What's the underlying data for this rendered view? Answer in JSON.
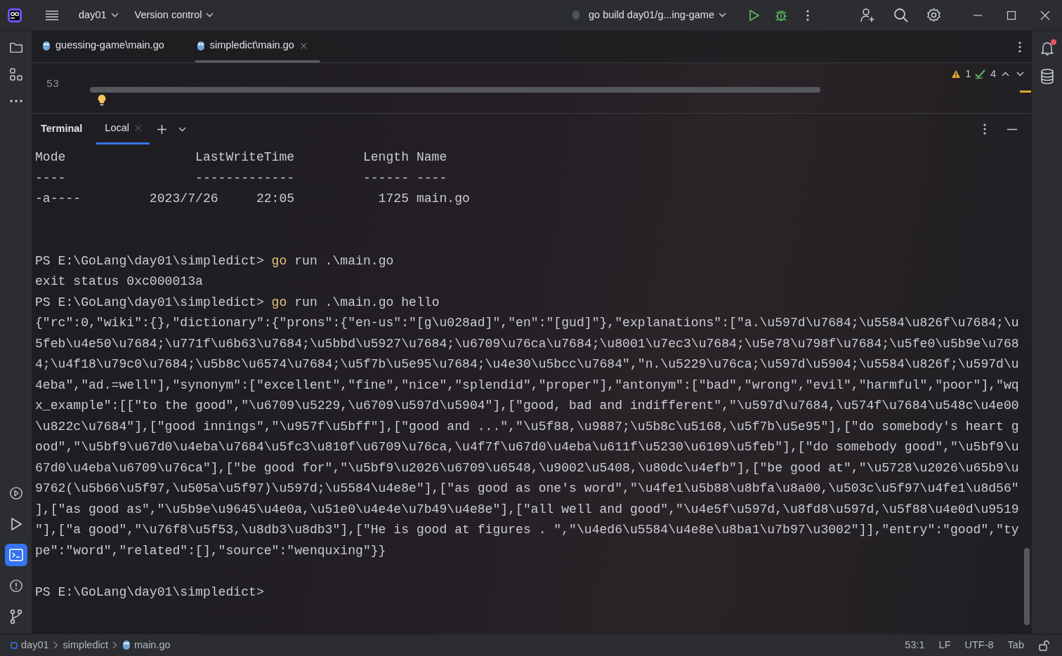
{
  "title_bar": {
    "project": "day01",
    "vcs": "Version control",
    "run_config": "go build day01/g...ing-game"
  },
  "left_toolbar": {
    "top": [
      {
        "kind": "folder",
        "selected": false
      },
      {
        "kind": "structure",
        "selected": false
      },
      {
        "kind": "more",
        "selected": false
      }
    ],
    "bottom": [
      {
        "kind": "services",
        "selected": false
      },
      {
        "kind": "run",
        "selected": false
      },
      {
        "kind": "terminal",
        "selected": true
      },
      {
        "kind": "problems",
        "selected": false
      },
      {
        "kind": "git",
        "selected": false
      }
    ]
  },
  "right_toolbar": [
    {
      "kind": "notifications",
      "unread": true
    },
    {
      "kind": "database",
      "unread": false
    }
  ],
  "editor_tabs": [
    {
      "label": "guessing-game\\main.go",
      "selected": false,
      "closable": false
    },
    {
      "label": "simpledict\\main.go",
      "selected": true,
      "closable": true
    }
  ],
  "editor": {
    "line_number": "53",
    "warnings": "1",
    "checks": "4"
  },
  "terminal": {
    "title": "Terminal",
    "tabs": [
      {
        "label": "Local",
        "selected": true
      }
    ],
    "lines": [
      {
        "kind": "output",
        "text": "Mode                 LastWriteTime         Length Name"
      },
      {
        "kind": "output",
        "text": "----                 -------------         ------ ----"
      },
      {
        "kind": "output",
        "text": "-a----         2023/7/26     22:05           1725 main.go"
      },
      {
        "kind": "blank"
      },
      {
        "kind": "blank"
      },
      {
        "kind": "prompt",
        "prompt": "PS E:\\GoLang\\day01\\simpledict>",
        "command": "go",
        "args": "run .\\main.go"
      },
      {
        "kind": "output",
        "text": "exit status 0xc000013a"
      },
      {
        "kind": "prompt",
        "prompt": "PS E:\\GoLang\\day01\\simpledict>",
        "command": "go",
        "args": "run .\\main.go hello"
      },
      {
        "kind": "output",
        "text": "{\"rc\":0,\"wiki\":{},\"dictionary\":{\"prons\":{\"en-us\":\"[g\\u028ad]\",\"en\":\"[gud]\"},\"explanations\":[\"a.\\u597d\\u7684;\\u5584\\u826f\\u7684;\\u"
      },
      {
        "kind": "output",
        "text": "5feb\\u4e50\\u7684;\\u771f\\u6b63\\u7684;\\u5bbd\\u5927\\u7684;\\u6709\\u76ca\\u7684;\\u8001\\u7ec3\\u7684;\\u5e78\\u798f\\u7684;\\u5fe0\\u5b9e\\u768"
      },
      {
        "kind": "output",
        "text": "4;\\u4f18\\u79c0\\u7684;\\u5b8c\\u6574\\u7684;\\u5f7b\\u5e95\\u7684;\\u4e30\\u5bcc\\u7684\",\"n.\\u5229\\u76ca;\\u597d\\u5904;\\u5584\\u826f;\\u597d\\u"
      },
      {
        "kind": "output",
        "text": "4eba\",\"ad.=well\"],\"synonym\":[\"excellent\",\"fine\",\"nice\",\"splendid\",\"proper\"],\"antonym\":[\"bad\",\"wrong\",\"evil\",\"harmful\",\"poor\"],\"wq"
      },
      {
        "kind": "output",
        "text": "x_example\":[[\"to the good\",\"\\u6709\\u5229,\\u6709\\u597d\\u5904\"],[\"good, bad and indifferent\",\"\\u597d\\u7684,\\u574f\\u7684\\u548c\\u4e00"
      },
      {
        "kind": "output",
        "text": "\\u822c\\u7684\"],[\"good innings\",\"\\u957f\\u5bff\"],[\"good and ...\",\"\\u5f88,\\u9887;\\u5b8c\\u5168,\\u5f7b\\u5e95\"],[\"do somebody's heart g"
      },
      {
        "kind": "output",
        "text": "ood\",\"\\u5bf9\\u67d0\\u4eba\\u7684\\u5fc3\\u810f\\u6709\\u76ca,\\u4f7f\\u67d0\\u4eba\\u611f\\u5230\\u6109\\u5feb\"],[\"do somebody good\",\"\\u5bf9\\u"
      },
      {
        "kind": "output",
        "text": "67d0\\u4eba\\u6709\\u76ca\"],[\"be good for\",\"\\u5bf9\\u2026\\u6709\\u6548,\\u9002\\u5408,\\u80dc\\u4efb\"],[\"be good at\",\"\\u5728\\u2026\\u65b9\\u"
      },
      {
        "kind": "output",
        "text": "9762(\\u5b66\\u5f97,\\u505a\\u5f97)\\u597d;\\u5584\\u4e8e\"],[\"as good as one's word\",\"\\u4fe1\\u5b88\\u8bfa\\u8a00,\\u503c\\u5f97\\u4fe1\\u8d56\""
      },
      {
        "kind": "output",
        "text": "],[\"as good as\",\"\\u5b9e\\u9645\\u4e0a,\\u51e0\\u4e4e\\u7b49\\u4e8e\"],[\"all well and good\",\"\\u4e5f\\u597d,\\u8fd8\\u597d,\\u5f88\\u4e0d\\u9519"
      },
      {
        "kind": "output",
        "text": "\"],[\"a good\",\"\\u76f8\\u5f53,\\u8db3\\u8db3\"],[\"He is good at figures . \",\"\\u4ed6\\u5584\\u4e8e\\u8ba1\\u7b97\\u3002\"]],\"entry\":\"good\",\"ty"
      },
      {
        "kind": "output",
        "text": "pe\":\"word\",\"related\":[],\"source\":\"wenquxing\"}}"
      },
      {
        "kind": "blank"
      },
      {
        "kind": "prompt",
        "prompt": "PS E:\\GoLang\\day01\\simpledict>"
      }
    ]
  },
  "status_bar": {
    "breadcrumbs": [
      "day01",
      "simpledict",
      "main.go"
    ],
    "position": "53:1",
    "line_separator": "LF",
    "encoding": "UTF-8",
    "indent": "Tab"
  }
}
